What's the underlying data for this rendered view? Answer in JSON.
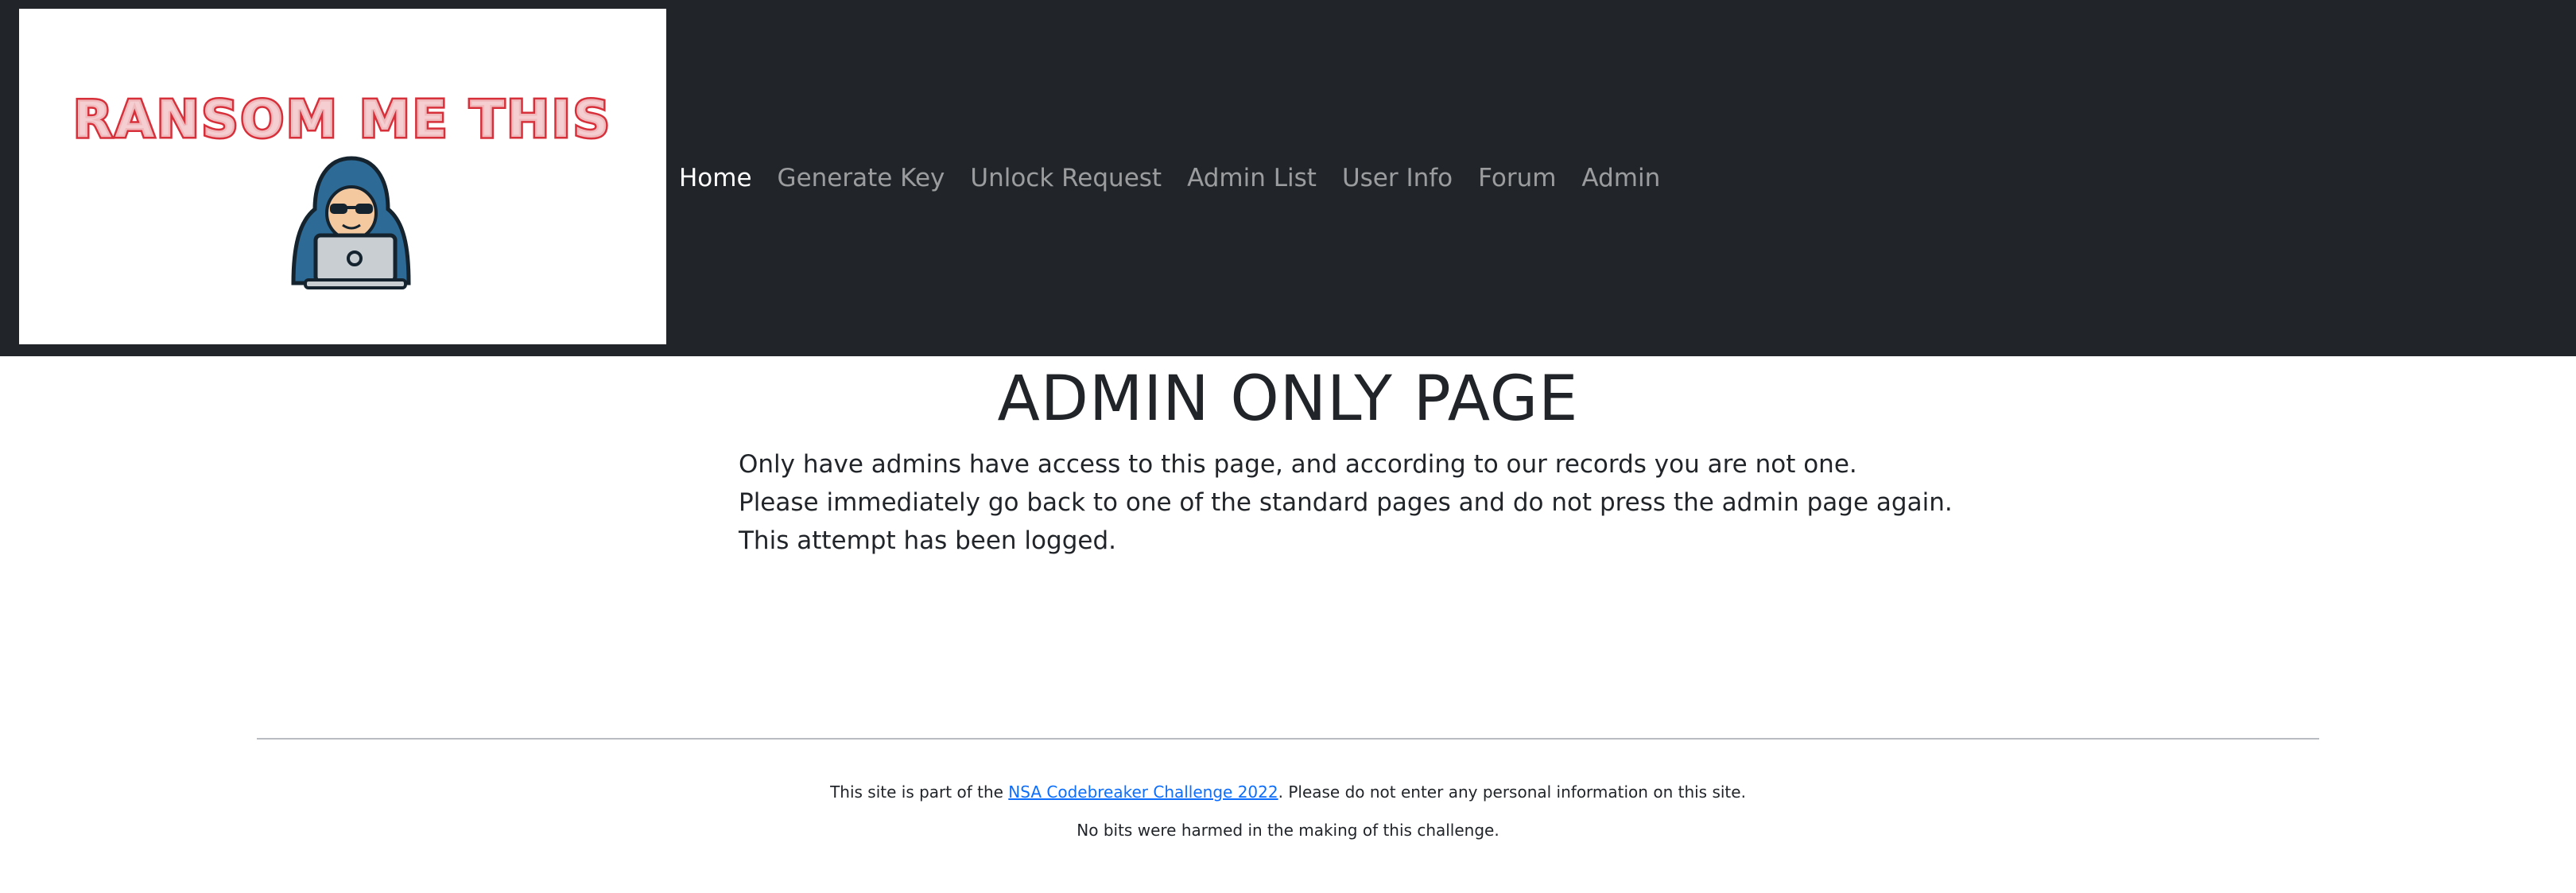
{
  "logo": {
    "text": "RANSOM ME THIS",
    "icon": "hooded-hacker-laptop-icon",
    "brand_color": "#d7303a"
  },
  "nav": {
    "items": [
      {
        "label": "Home",
        "active": true
      },
      {
        "label": "Generate Key",
        "active": false
      },
      {
        "label": "Unlock Request",
        "active": false
      },
      {
        "label": "Admin List",
        "active": false
      },
      {
        "label": "User Info",
        "active": false
      },
      {
        "label": "Forum",
        "active": false
      },
      {
        "label": "Admin",
        "active": false
      }
    ]
  },
  "main": {
    "title": "ADMIN ONLY PAGE",
    "lines": [
      "Only have admins have access to this page, and according to our records you are not one.",
      "Please immediately go back to one of the standard pages and do not press the admin page again.",
      "This attempt has been logged."
    ]
  },
  "footer": {
    "line1_prefix": "This site is part of the ",
    "line1_link": "NSA Codebreaker Challenge 2022",
    "line1_suffix": ". Please do not enter any personal information on this site.",
    "line2": "No bits were harmed in the making of this challenge."
  },
  "colors": {
    "navbar_bg": "#212529",
    "link": "#0d6efd",
    "text": "#212529"
  }
}
